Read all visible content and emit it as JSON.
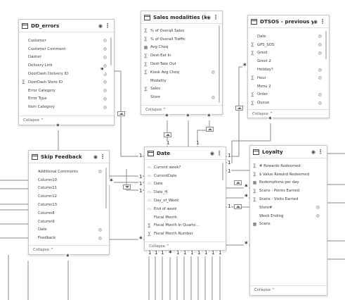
{
  "tables": {
    "dd_errors": {
      "title": "DD_errors",
      "fields": [
        {
          "icon": "",
          "name": "Customer",
          "hidden": true
        },
        {
          "icon": "",
          "name": "Customer Comment",
          "hidden": true
        },
        {
          "icon": "",
          "name": "Dasher",
          "hidden": true
        },
        {
          "icon": "",
          "name": "Delivery Link",
          "hidden": true
        },
        {
          "icon": "",
          "name": "DoorDash Delivery ID",
          "hidden": true
        },
        {
          "icon": "sigma",
          "name": "DoorDash Store ID",
          "hidden": true
        },
        {
          "icon": "",
          "name": "Error Category",
          "hidden": true
        },
        {
          "icon": "",
          "name": "Error Type",
          "hidden": true
        },
        {
          "icon": "",
          "name": "Item Category",
          "hidden": true
        }
      ],
      "collapse": "Collapse ^"
    },
    "sales_modalities": {
      "title": "Sales modalities (kiosk)",
      "fields": [
        {
          "icon": "sigma",
          "name": "% of Overall Sales",
          "hidden": false
        },
        {
          "icon": "sigma",
          "name": "% of Overall Traffic",
          "hidden": false
        },
        {
          "icon": "calc",
          "name": "Avg Cheq",
          "hidden": false
        },
        {
          "icon": "sigma",
          "name": "Dest-Eat In",
          "hidden": false
        },
        {
          "icon": "sigma",
          "name": "Dest-Take Out",
          "hidden": false
        },
        {
          "icon": "sigma",
          "name": "Kiosk Avg Cheq",
          "hidden": true
        },
        {
          "icon": "",
          "name": "Modality",
          "hidden": false
        },
        {
          "icon": "sigma",
          "name": "Sales",
          "hidden": false
        },
        {
          "icon": "",
          "name": "Store",
          "hidden": true
        }
      ],
      "collapse": "Collapse ^"
    },
    "dtsos": {
      "title": "DTSOS - previous years",
      "fields": [
        {
          "icon": "",
          "name": "Date",
          "hidden": true
        },
        {
          "icon": "sigma",
          "name": "GPS_SOS",
          "hidden": true
        },
        {
          "icon": "sigma",
          "name": "Greet",
          "hidden": true
        },
        {
          "icon": "",
          "name": "Greet 2",
          "hidden": false
        },
        {
          "icon": "",
          "name": "Holiday?",
          "hidden": true
        },
        {
          "icon": "sigma",
          "name": "Hour",
          "hidden": true
        },
        {
          "icon": "",
          "name": "Menu 2",
          "hidden": false
        },
        {
          "icon": "sigma",
          "name": "Order",
          "hidden": true
        },
        {
          "icon": "sigma",
          "name": "Queue",
          "hidden": true
        }
      ],
      "collapse": "Collapse ^"
    },
    "skip_feedback": {
      "title": "Skip Feedback",
      "fields": [
        {
          "icon": "",
          "name": "Additional Comments",
          "hidden": true
        },
        {
          "icon": "",
          "name": "Column10",
          "hidden": false
        },
        {
          "icon": "",
          "name": "Column11",
          "hidden": false
        },
        {
          "icon": "",
          "name": "Column12",
          "hidden": false
        },
        {
          "icon": "",
          "name": "Column13",
          "hidden": false
        },
        {
          "icon": "",
          "name": "Column8",
          "hidden": false
        },
        {
          "icon": "",
          "name": "Column9",
          "hidden": false
        },
        {
          "icon": "",
          "name": "Date",
          "hidden": true
        },
        {
          "icon": "",
          "name": "Feedback",
          "hidden": true
        }
      ],
      "collapse": "Collapse ^"
    },
    "date": {
      "title": "Date",
      "fields": [
        {
          "icon": "cal",
          "name": "Current week?",
          "hidden": false
        },
        {
          "icon": "cal",
          "name": "CurrentDate",
          "hidden": false
        },
        {
          "icon": "cal",
          "name": "Date",
          "hidden": false
        },
        {
          "icon": "cal",
          "name": "Date_H",
          "hidden": false
        },
        {
          "icon": "cal",
          "name": "Day_of_Week",
          "hidden": false
        },
        {
          "icon": "cal",
          "name": "End of week",
          "hidden": false
        },
        {
          "icon": "",
          "name": "Fiscal Month",
          "hidden": false
        },
        {
          "icon": "sigma",
          "name": "Fiscal Month In Quarte...",
          "hidden": false
        },
        {
          "icon": "sigma",
          "name": "Fiscal Month Number",
          "hidden": false
        }
      ],
      "collapse": "Collapse ^"
    },
    "loyalty": {
      "title": "Loyalty",
      "fields": [
        {
          "icon": "sigma",
          "name": "# Rewards Redeemed",
          "hidden": false
        },
        {
          "icon": "sigma",
          "name": "$ Value Reward Redeemed",
          "hidden": false
        },
        {
          "icon": "calc",
          "name": "Redemptions per day",
          "hidden": false
        },
        {
          "icon": "sigma",
          "name": "Scans - Points Earned",
          "hidden": false
        },
        {
          "icon": "sigma",
          "name": "Scans - Visits Earned",
          "hidden": false
        },
        {
          "icon": "",
          "name": "Store#",
          "hidden": true
        },
        {
          "icon": "",
          "name": "Week Ending",
          "hidden": true
        },
        {
          "icon": "calc",
          "name": "Scans",
          "hidden": false
        }
      ],
      "collapse": "Collapse ^"
    }
  },
  "markers": {
    "one": "1",
    "many": "*"
  }
}
